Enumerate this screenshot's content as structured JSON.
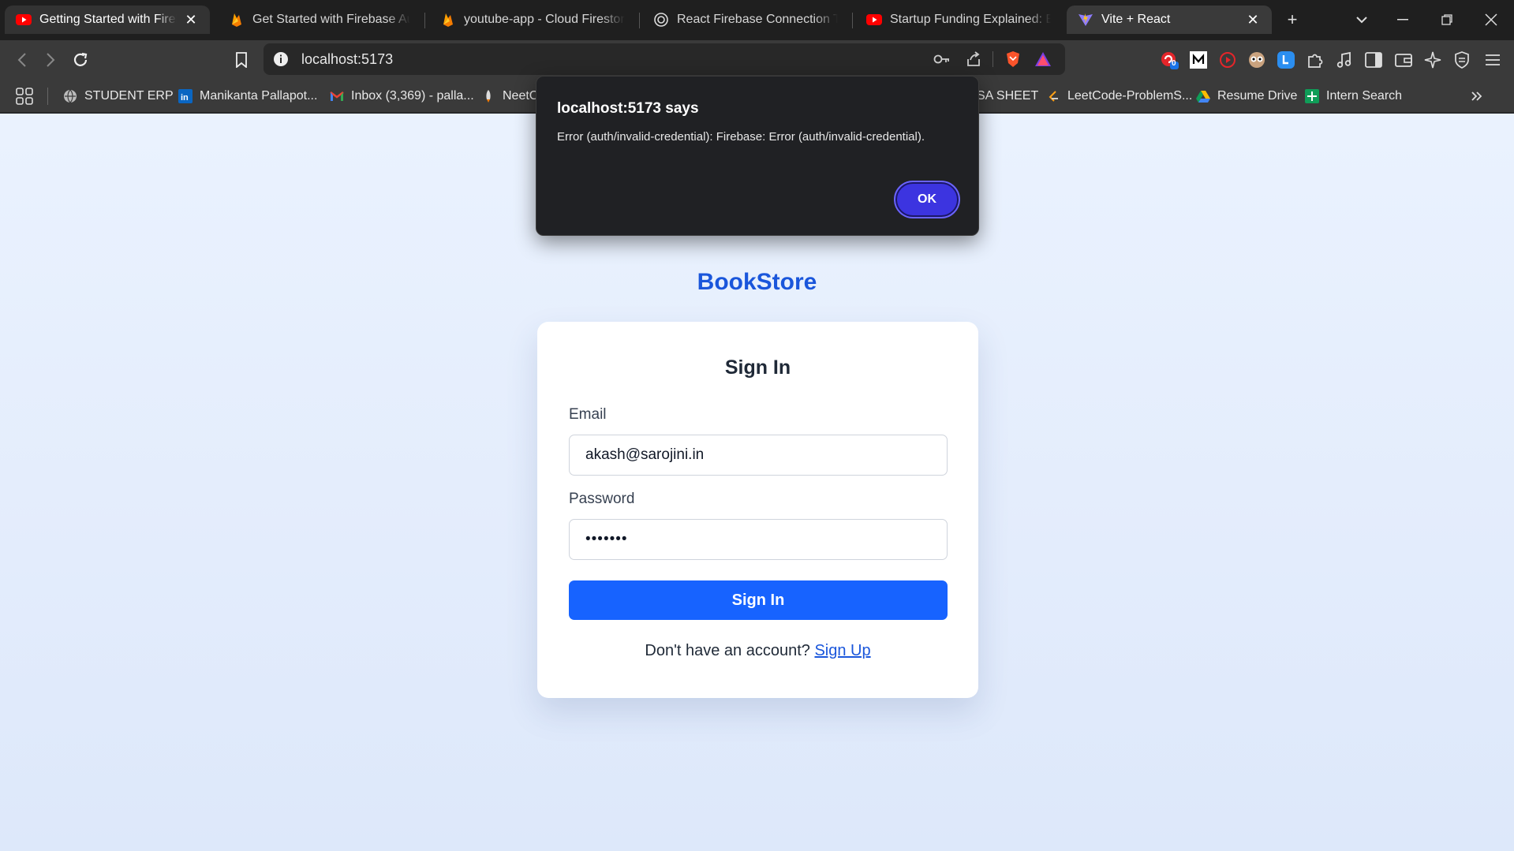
{
  "tabs": [
    {
      "title": "Getting Started with Fireba",
      "icon": "youtube-icon"
    },
    {
      "title": "Get Started with Firebase Authe",
      "icon": "firebase-icon"
    },
    {
      "title": "youtube-app - Cloud Firestore",
      "icon": "firebase-icon"
    },
    {
      "title": "React Firebase Connection Test",
      "icon": "globe-icon"
    },
    {
      "title": "Startup Funding Explained: Eve",
      "icon": "youtube-icon"
    },
    {
      "title": "Vite + React",
      "icon": "vite-icon"
    }
  ],
  "address": {
    "url": "localhost:5173"
  },
  "extensions": {
    "badge_count": "0"
  },
  "bookmarks": [
    {
      "label": "STUDENT ERP",
      "icon": "globe-icon"
    },
    {
      "label": "Manikanta Pallapot...",
      "icon": "linkedin-icon"
    },
    {
      "label": "Inbox (3,369) - palla...",
      "icon": "gmail-icon"
    },
    {
      "label": "NeetC",
      "icon": "rocket-icon"
    },
    {
      "label": "SA SHEET",
      "icon": ""
    },
    {
      "label": "LeetCode-ProblemS...",
      "icon": "leetcode-icon"
    },
    {
      "label": "Resume Drive",
      "icon": "drive-icon"
    },
    {
      "label": "Intern Search",
      "icon": "sheets-icon"
    }
  ],
  "page": {
    "brand": "BookStore",
    "heading": "Sign In",
    "email_label": "Email",
    "email_value": "akash@sarojini.in",
    "password_label": "Password",
    "password_value": "•••••••",
    "submit_label": "Sign In",
    "signup_prompt": "Don't have an account?",
    "signup_link": "Sign Up"
  },
  "dialog": {
    "title": "localhost:5173 says",
    "message": "Error (auth/invalid-credential): Firebase: Error (auth/invalid-credential).",
    "ok_label": "OK"
  },
  "colors": {
    "brand": "#1a56db",
    "primary_button": "#1763ff",
    "dialog_ok": "#3c34e0"
  }
}
